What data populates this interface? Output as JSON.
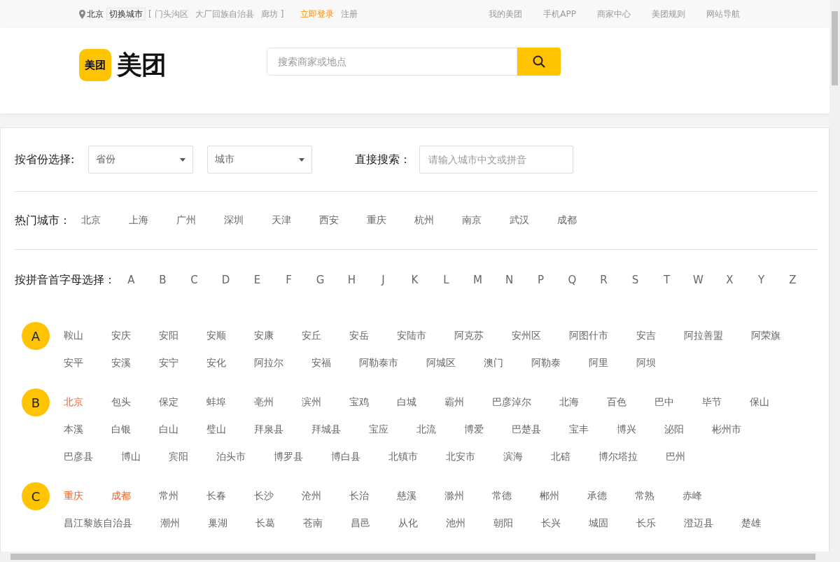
{
  "top_bar": {
    "location": "北京",
    "switch_city": "切换城市",
    "bracket_open": "[",
    "nearby": [
      "门头沟区",
      "大厂回族自治县",
      "廊坊"
    ],
    "bracket_close": "]",
    "login": "立即登录",
    "register": "注册",
    "links": [
      "我的美团",
      "手机APP",
      "商家中心",
      "美团规则",
      "网站导航"
    ]
  },
  "header": {
    "logo_icon_text": "美团",
    "logo_text": "美团",
    "search": {
      "placeholder": "搜索商家或地点"
    }
  },
  "filter": {
    "province_label": "按省份选择:",
    "province_select": "省份",
    "city_select": "城市",
    "search_label": "直接搜索：",
    "search_placeholder": "请输入城市中文或拼音"
  },
  "hot_cities": {
    "label": "热门城市：",
    "cities": [
      "北京",
      "上海",
      "广州",
      "深圳",
      "天津",
      "西安",
      "重庆",
      "杭州",
      "南京",
      "武汉",
      "成都"
    ]
  },
  "pinyin": {
    "label": "按拼音首字母选择：",
    "letters": [
      "A",
      "B",
      "C",
      "D",
      "E",
      "F",
      "G",
      "H",
      "J",
      "K",
      "L",
      "M",
      "N",
      "P",
      "Q",
      "R",
      "S",
      "T",
      "W",
      "X",
      "Y",
      "Z"
    ]
  },
  "groups": [
    {
      "letter": "A",
      "cities": [
        {
          "name": "鞍山",
          "hot": false
        },
        {
          "name": "安庆",
          "hot": false
        },
        {
          "name": "安阳",
          "hot": false
        },
        {
          "name": "安顺",
          "hot": false
        },
        {
          "name": "安康",
          "hot": false
        },
        {
          "name": "安丘",
          "hot": false
        },
        {
          "name": "安岳",
          "hot": false
        },
        {
          "name": "安陆市",
          "hot": false
        },
        {
          "name": "阿克苏",
          "hot": false
        },
        {
          "name": "安州区",
          "hot": false
        },
        {
          "name": "阿图什市",
          "hot": false
        },
        {
          "name": "安吉",
          "hot": false
        },
        {
          "name": "阿拉善盟",
          "hot": false
        },
        {
          "name": "阿荣旗",
          "hot": false
        },
        {
          "name": "安平",
          "hot": false
        },
        {
          "name": "安溪",
          "hot": false
        },
        {
          "name": "安宁",
          "hot": false
        },
        {
          "name": "安化",
          "hot": false
        },
        {
          "name": "阿拉尔",
          "hot": false
        },
        {
          "name": "安福",
          "hot": false
        },
        {
          "name": "阿勒泰市",
          "hot": false
        },
        {
          "name": "阿城区",
          "hot": false
        },
        {
          "name": "澳门",
          "hot": false
        },
        {
          "name": "阿勒泰",
          "hot": false
        },
        {
          "name": "阿里",
          "hot": false
        },
        {
          "name": "阿坝",
          "hot": false
        }
      ]
    },
    {
      "letter": "B",
      "cities": [
        {
          "name": "北京",
          "hot": true
        },
        {
          "name": "包头",
          "hot": false
        },
        {
          "name": "保定",
          "hot": false
        },
        {
          "name": "蚌埠",
          "hot": false
        },
        {
          "name": "亳州",
          "hot": false
        },
        {
          "name": "滨州",
          "hot": false
        },
        {
          "name": "宝鸡",
          "hot": false
        },
        {
          "name": "白城",
          "hot": false
        },
        {
          "name": "霸州",
          "hot": false
        },
        {
          "name": "巴彦淖尔",
          "hot": false
        },
        {
          "name": "北海",
          "hot": false
        },
        {
          "name": "百色",
          "hot": false
        },
        {
          "name": "巴中",
          "hot": false
        },
        {
          "name": "毕节",
          "hot": false
        },
        {
          "name": "保山",
          "hot": false
        },
        {
          "name": "本溪",
          "hot": false
        },
        {
          "name": "白银",
          "hot": false
        },
        {
          "name": "白山",
          "hot": false
        },
        {
          "name": "璧山",
          "hot": false
        },
        {
          "name": "拜泉县",
          "hot": false
        },
        {
          "name": "拜城县",
          "hot": false
        },
        {
          "name": "宝应",
          "hot": false
        },
        {
          "name": "北流",
          "hot": false
        },
        {
          "name": "博爱",
          "hot": false
        },
        {
          "name": "巴楚县",
          "hot": false
        },
        {
          "name": "宝丰",
          "hot": false
        },
        {
          "name": "博兴",
          "hot": false
        },
        {
          "name": "泌阳",
          "hot": false
        },
        {
          "name": "彬州市",
          "hot": false
        },
        {
          "name": "巴彦县",
          "hot": false
        },
        {
          "name": "博山",
          "hot": false
        },
        {
          "name": "宾阳",
          "hot": false
        },
        {
          "name": "泊头市",
          "hot": false
        },
        {
          "name": "博罗县",
          "hot": false
        },
        {
          "name": "博白县",
          "hot": false
        },
        {
          "name": "北镇市",
          "hot": false
        },
        {
          "name": "北安市",
          "hot": false
        },
        {
          "name": "滨海",
          "hot": false
        },
        {
          "name": "北碚",
          "hot": false
        },
        {
          "name": "博尔塔拉",
          "hot": false
        },
        {
          "name": "巴州",
          "hot": false
        }
      ]
    },
    {
      "letter": "C",
      "cities": [
        {
          "name": "重庆",
          "hot": true
        },
        {
          "name": "成都",
          "hot": true
        },
        {
          "name": "常州",
          "hot": false
        },
        {
          "name": "长春",
          "hot": false
        },
        {
          "name": "长沙",
          "hot": false
        },
        {
          "name": "沧州",
          "hot": false
        },
        {
          "name": "长治",
          "hot": false
        },
        {
          "name": "慈溪",
          "hot": false
        },
        {
          "name": "滁州",
          "hot": false
        },
        {
          "name": "常德",
          "hot": false
        },
        {
          "name": "郴州",
          "hot": false
        },
        {
          "name": "承德",
          "hot": false
        },
        {
          "name": "常熟",
          "hot": false
        },
        {
          "name": "赤峰",
          "hot": false
        },
        {
          "name": "昌江黎族自治县",
          "hot": false
        },
        {
          "name": "潮州",
          "hot": false
        },
        {
          "name": "巢湖",
          "hot": false
        },
        {
          "name": "长葛",
          "hot": false
        },
        {
          "name": "苍南",
          "hot": false
        },
        {
          "name": "昌邑",
          "hot": false
        },
        {
          "name": "从化",
          "hot": false
        },
        {
          "name": "池州",
          "hot": false
        },
        {
          "name": "朝阳",
          "hot": false
        },
        {
          "name": "长兴",
          "hot": false
        },
        {
          "name": "城固",
          "hot": false
        },
        {
          "name": "长乐",
          "hot": false
        },
        {
          "name": "澄迈县",
          "hot": false
        },
        {
          "name": "楚雄",
          "hot": false
        }
      ]
    }
  ]
}
